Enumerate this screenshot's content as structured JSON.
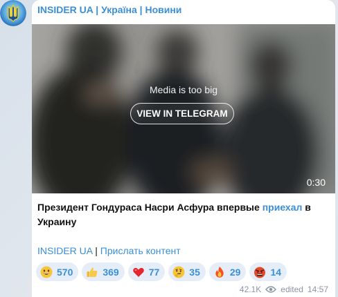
{
  "channel": {
    "title": "INSIDER UA | Україна | Новини"
  },
  "media": {
    "note": "Media is too big",
    "button_label": "VIEW IN TELEGRAM",
    "duration": "0:30"
  },
  "post": {
    "text_before": "Президент Гондураса Насри Асфура впервые ",
    "link_text": "приехал",
    "text_after": " в Украину"
  },
  "footer": {
    "link1": "INSIDER UA",
    "separator": " | ",
    "link2": "Прислать контент"
  },
  "reactions": [
    {
      "icon": "grinning-face-icon",
      "count": "570"
    },
    {
      "icon": "thumbs-up-icon",
      "count": "369"
    },
    {
      "icon": "red-heart-icon",
      "count": "77"
    },
    {
      "icon": "thinking-face-icon",
      "count": "35"
    },
    {
      "icon": "fire-icon",
      "count": "29"
    },
    {
      "icon": "angry-face-icon",
      "count": "14"
    }
  ],
  "meta": {
    "views": "42.1K",
    "edited_label": "edited",
    "time": "14:57"
  },
  "colors": {
    "accent": "#3a8fd6",
    "reaction_bg": "#e5eef8",
    "meta_text": "#8a96a3"
  }
}
